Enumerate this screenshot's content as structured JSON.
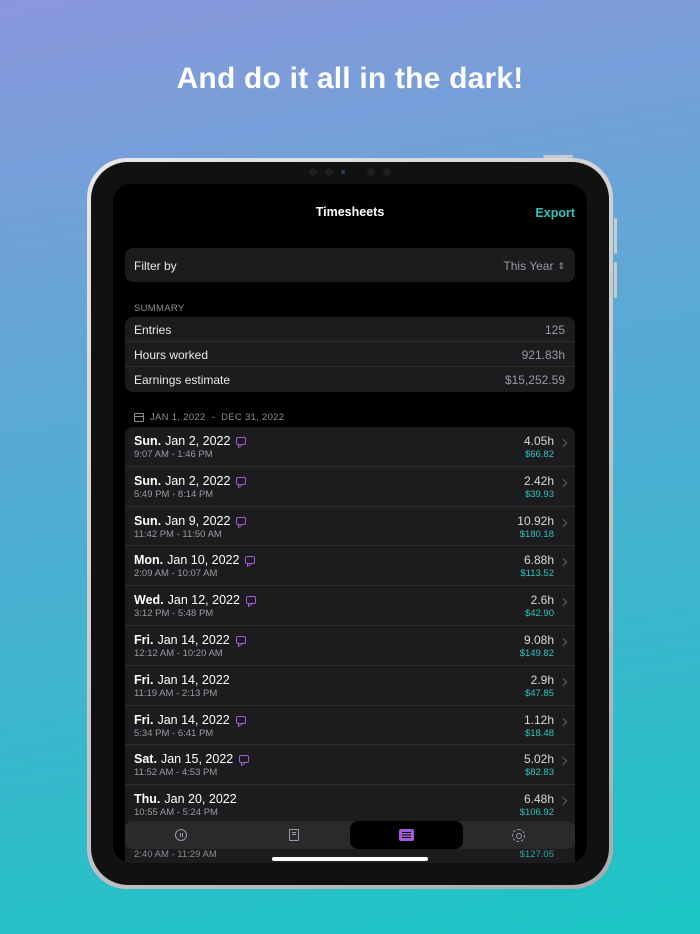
{
  "headline": "And do it all in the dark!",
  "navbar": {
    "title": "Timesheets",
    "export_label": "Export"
  },
  "filter": {
    "label": "Filter by",
    "value": "This Year"
  },
  "summary": {
    "heading": "SUMMARY",
    "rows": [
      {
        "label": "Entries",
        "value": "125"
      },
      {
        "label": "Hours worked",
        "value": "921.83h"
      },
      {
        "label": "Earnings estimate",
        "value": "$15,252.59"
      }
    ]
  },
  "range": {
    "start": "JAN 1, 2022",
    "separator": "-",
    "end": "DEC 31, 2022"
  },
  "entries": [
    {
      "weekday": "Sun.",
      "date": "Jan 2, 2022",
      "has_note": true,
      "time": "9:07 AM - 1:46 PM",
      "hours": "4.05h",
      "amount": "$66.82"
    },
    {
      "weekday": "Sun.",
      "date": "Jan 2, 2022",
      "has_note": true,
      "time": "5:49 PM - 8:14 PM",
      "hours": "2.42h",
      "amount": "$39.93"
    },
    {
      "weekday": "Sun.",
      "date": "Jan 9, 2022",
      "has_note": true,
      "time": "11:42 PM - 11:50 AM",
      "hours": "10.92h",
      "amount": "$180.18"
    },
    {
      "weekday": "Mon.",
      "date": "Jan 10, 2022",
      "has_note": true,
      "time": "2:09 AM - 10:07 AM",
      "hours": "6.88h",
      "amount": "$113.52"
    },
    {
      "weekday": "Wed.",
      "date": "Jan 12, 2022",
      "has_note": true,
      "time": "3:12 PM - 5:48 PM",
      "hours": "2.6h",
      "amount": "$42.90"
    },
    {
      "weekday": "Fri.",
      "date": "Jan 14, 2022",
      "has_note": true,
      "time": "12:12 AM - 10:20 AM",
      "hours": "9.08h",
      "amount": "$149.82"
    },
    {
      "weekday": "Fri.",
      "date": "Jan 14, 2022",
      "has_note": false,
      "time": "11:19 AM - 2:13 PM",
      "hours": "2.9h",
      "amount": "$47.85"
    },
    {
      "weekday": "Fri.",
      "date": "Jan 14, 2022",
      "has_note": true,
      "time": "5:34 PM - 6:41 PM",
      "hours": "1.12h",
      "amount": "$18.48"
    },
    {
      "weekday": "Sat.",
      "date": "Jan 15, 2022",
      "has_note": true,
      "time": "11:52 AM - 4:53 PM",
      "hours": "5.02h",
      "amount": "$82.83"
    },
    {
      "weekday": "Thu.",
      "date": "Jan 20, 2022",
      "has_note": false,
      "time": "10:55 AM - 5:24 PM",
      "hours": "6.48h",
      "amount": "$106.92"
    }
  ],
  "peek_entry": {
    "time": "2:40 AM - 11:29 AM",
    "amount": "$127.05"
  },
  "tabbar": {
    "tabs": [
      {
        "icon": "pause-circle-icon",
        "active": false
      },
      {
        "icon": "book-icon",
        "active": false
      },
      {
        "icon": "list-icon",
        "active": true
      },
      {
        "icon": "gear-icon",
        "active": false
      }
    ]
  },
  "colors": {
    "accent_teal": "#2ec4bd",
    "accent_purple": "#a25bd9",
    "background": "#000000"
  }
}
